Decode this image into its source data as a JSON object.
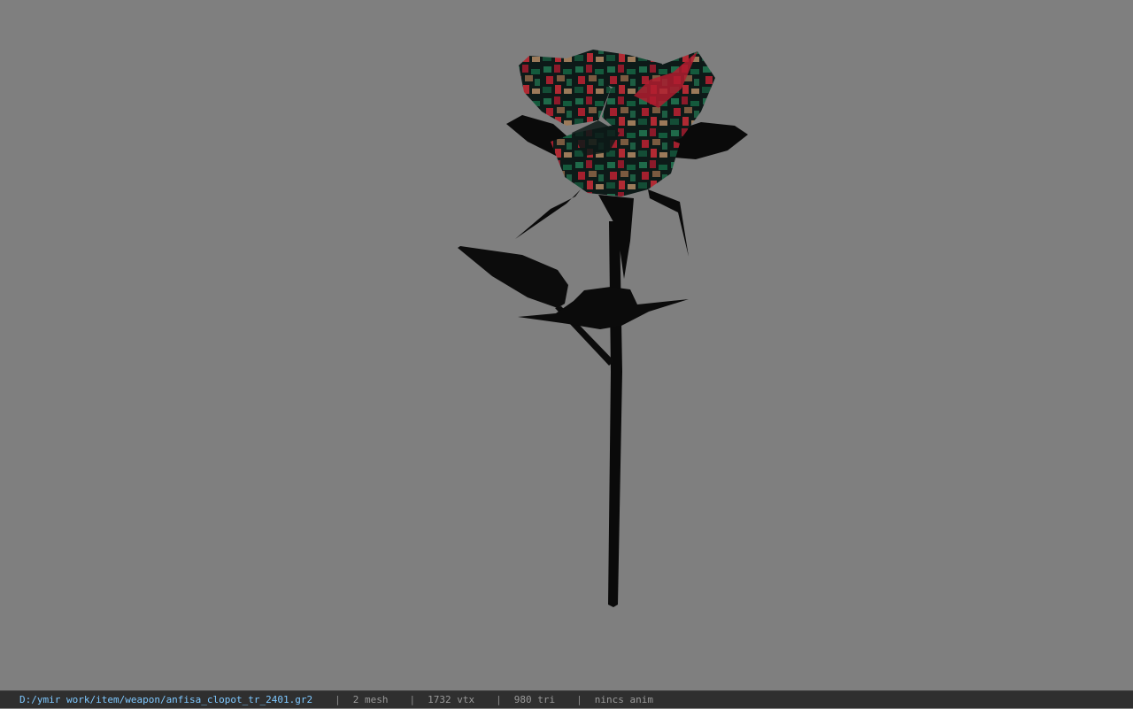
{
  "viewer": {
    "background_color": "#7f7f7f",
    "model": "rose-mesh"
  },
  "statusbar": {
    "file_path": "D:/ymir work/item/weapon/anfisa_clopot_tr_2401.gr2",
    "separator": "|",
    "mesh_count": "2 mesh",
    "vertex_count": "1732 vtx",
    "triangle_count": "980 tri",
    "anim_status": "nincs anim"
  }
}
